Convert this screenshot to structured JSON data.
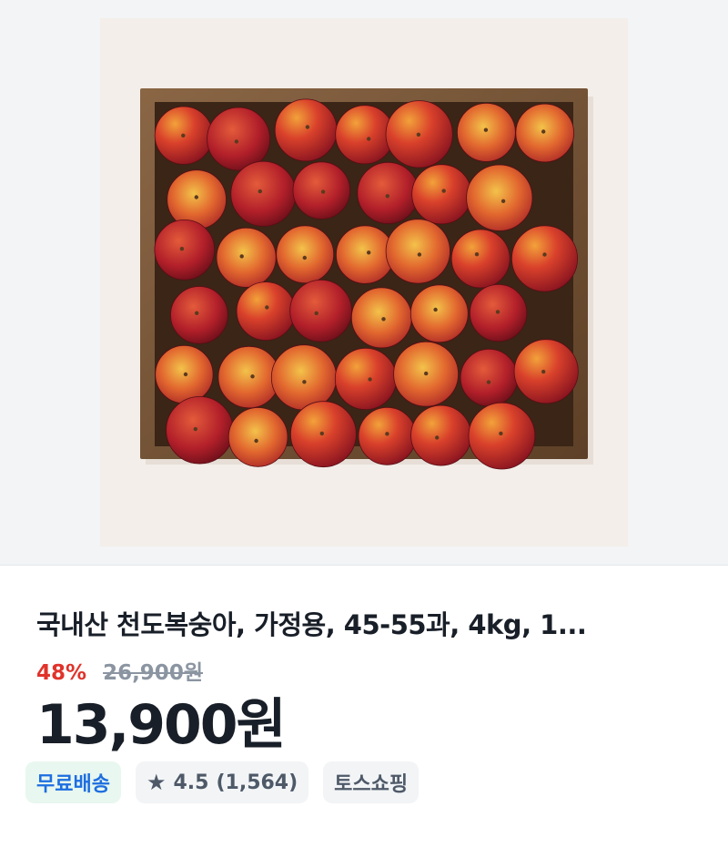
{
  "product": {
    "image_alt": "천도복숭아 상자",
    "title": "국내산 천도복숭아, 가정용, 45-55과, 4kg, 1...",
    "discount_rate": "48%",
    "original_price": "26,900원",
    "sale_price": "13,900원"
  },
  "badges": {
    "shipping": "무료배송",
    "rating_icon": "star-icon",
    "rating_value": "4.5",
    "rating_count": "(1,564)",
    "seller": "토스쇼핑"
  },
  "colors": {
    "discount": "#e0332a",
    "shipping_text": "#1d6ee0",
    "shipping_bg": "#e8f7ef"
  }
}
